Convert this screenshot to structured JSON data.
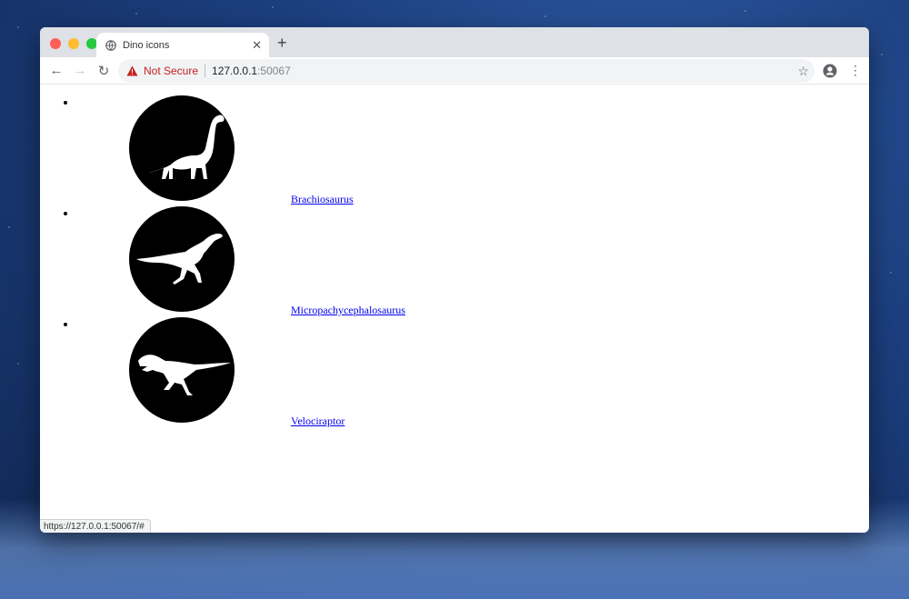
{
  "browser": {
    "tab_title": "Dino icons",
    "security_label": "Not Secure",
    "url_host": "127.0.0.1",
    "url_port": ":50067",
    "status_url": "https://127.0.0.1:50067/#"
  },
  "dinosaurs": [
    {
      "name": "Brachiosaurus",
      "icon": "brachiosaurus-icon"
    },
    {
      "name": "Micropachycephalosaurus",
      "icon": "micropachycephalosaurus-icon"
    },
    {
      "name": "Velociraptor",
      "icon": "velociraptor-icon"
    }
  ],
  "colors": {
    "link": "#0000ee",
    "icon_background": "#000000",
    "insecure_red": "#c5221f"
  }
}
